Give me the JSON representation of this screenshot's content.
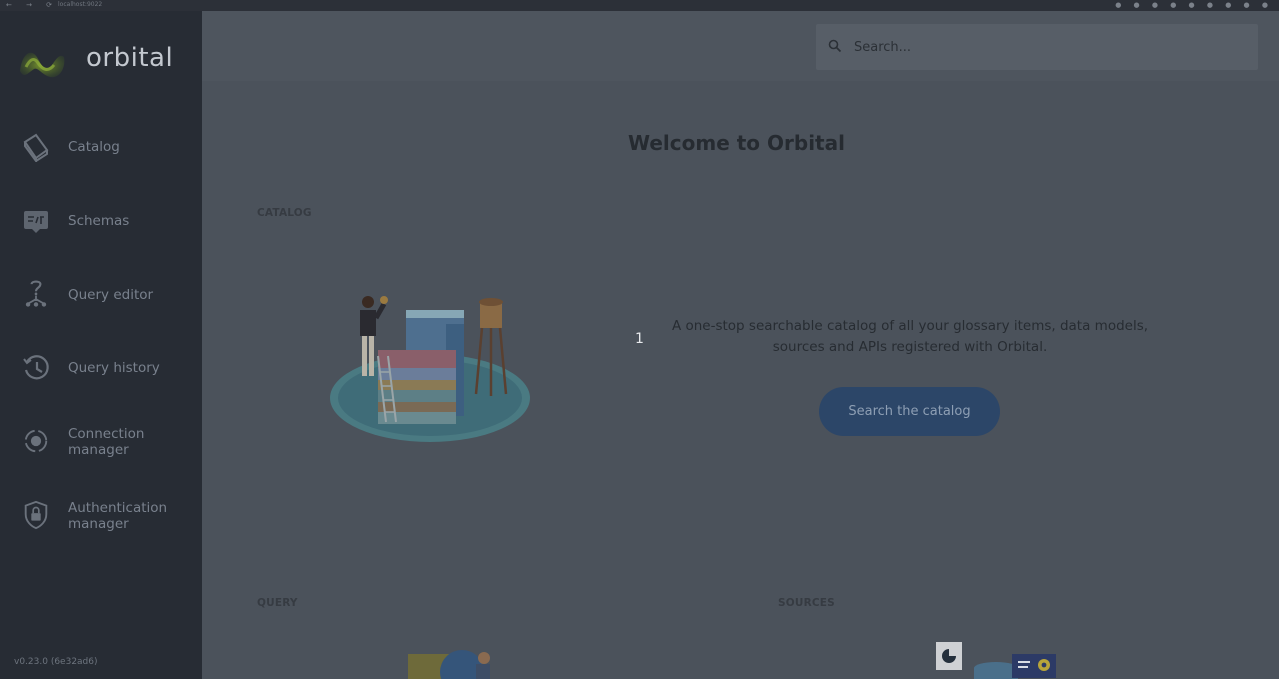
{
  "browser": {
    "nav_icons": "← → ⟳",
    "url": "localhost:9022",
    "extension_icons": "● ● ● ● ● ● ● ● ●"
  },
  "sidebar": {
    "logo_text": "orbital",
    "items": [
      {
        "label": "Catalog",
        "icon": "catalog-book-icon"
      },
      {
        "label": "Schemas",
        "icon": "schemas-icon"
      },
      {
        "label": "Query editor",
        "icon": "query-editor-icon"
      },
      {
        "label": "Query history",
        "icon": "history-clock-icon"
      },
      {
        "label": "Connection manager",
        "icon": "connection-icon"
      },
      {
        "label": "Authentication manager",
        "icon": "shield-lock-icon"
      }
    ],
    "version": "v0.23.0 (6e32ad6)"
  },
  "search": {
    "placeholder": "Search..."
  },
  "main": {
    "title": "Welcome to Orbital",
    "catalog": {
      "label": "CATALOG",
      "slide_number": "1",
      "description": "A one-stop searchable catalog of all your glossary items, data models, sources and APIs registered with Orbital.",
      "button": "Search the catalog"
    },
    "query": {
      "label": "QUERY"
    },
    "sources": {
      "label": "SOURCES"
    }
  },
  "colors": {
    "sidebar_bg": "#272c34",
    "content_bg": "#4b525b",
    "accent_button": "#2c4668",
    "logo_green": "#6f8a2c"
  }
}
